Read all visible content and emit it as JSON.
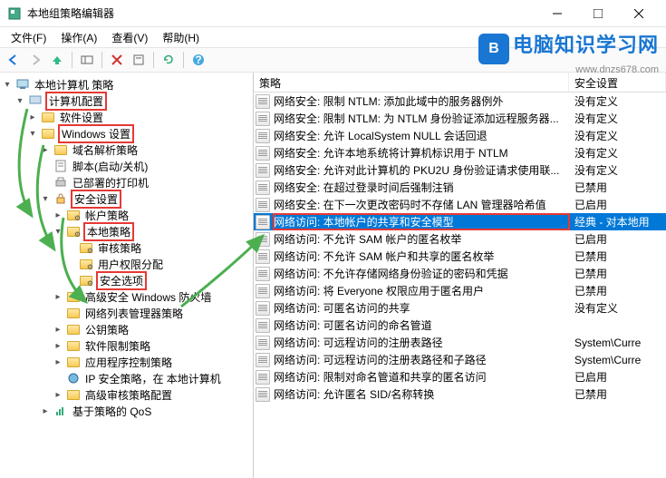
{
  "window": {
    "title": "本地组策略编辑器"
  },
  "menubar": [
    "文件(F)",
    "操作(A)",
    "查看(V)",
    "帮助(H)"
  ],
  "watermark": {
    "cn": "电脑知识学习网",
    "en": "www.dnzs678.com"
  },
  "tree": {
    "root": "本地计算机 策略",
    "n0": "计算机配置",
    "n1": "软件设置",
    "n2": "Windows 设置",
    "n3": "域名解析策略",
    "n4": "脚本(启动/关机)",
    "n5": "已部署的打印机",
    "n6": "安全设置",
    "n7": "帐户策略",
    "n8": "本地策略",
    "n9": "审核策略",
    "n10": "用户权限分配",
    "n11": "安全选项",
    "n12": "高级安全 Windows 防火墙",
    "n13": "网络列表管理器策略",
    "n14": "公钥策略",
    "n15": "软件限制策略",
    "n16": "应用程序控制策略",
    "n17": "IP 安全策略，在 本地计算机",
    "n18": "高级审核策略配置",
    "n19": "基于策略的 QoS"
  },
  "list": {
    "hdr_policy": "策略",
    "hdr_setting": "安全设置",
    "items": [
      {
        "t": "网络安全: 限制 NTLM: 添加此域中的服务器例外",
        "v": "没有定义"
      },
      {
        "t": "网络安全: 限制 NTLM: 为 NTLM 身份验证添加远程服务器...",
        "v": "没有定义"
      },
      {
        "t": "网络安全: 允许 LocalSystem NULL 会话回退",
        "v": "没有定义"
      },
      {
        "t": "网络安全: 允许本地系统将计算机标识用于 NTLM",
        "v": "没有定义"
      },
      {
        "t": "网络安全: 允许对此计算机的 PKU2U 身份验证请求使用联...",
        "v": "没有定义"
      },
      {
        "t": "网络安全: 在超过登录时间后强制注销",
        "v": "已禁用"
      },
      {
        "t": "网络安全: 在下一次更改密码时不存储 LAN 管理器哈希值",
        "v": "已启用"
      },
      {
        "t": "网络访问: 本地帐户的共享和安全模型",
        "v": "经典 - 对本地用",
        "sel": true
      },
      {
        "t": "网络访问: 不允许 SAM 帐户的匿名枚举",
        "v": "已启用"
      },
      {
        "t": "网络访问: 不允许 SAM 帐户和共享的匿名枚举",
        "v": "已禁用"
      },
      {
        "t": "网络访问: 不允许存储网络身份验证的密码和凭据",
        "v": "已禁用"
      },
      {
        "t": "网络访问: 将 Everyone 权限应用于匿名用户",
        "v": "已禁用"
      },
      {
        "t": "网络访问: 可匿名访问的共享",
        "v": "没有定义"
      },
      {
        "t": "网络访问: 可匿名访问的命名管道",
        "v": ""
      },
      {
        "t": "网络访问: 可远程访问的注册表路径",
        "v": "System\\Curre"
      },
      {
        "t": "网络访问: 可远程访问的注册表路径和子路径",
        "v": "System\\Curre"
      },
      {
        "t": "网络访问: 限制对命名管道和共享的匿名访问",
        "v": "已启用"
      },
      {
        "t": "网络访问: 允许匿名 SID/名称转换",
        "v": "已禁用"
      }
    ]
  }
}
